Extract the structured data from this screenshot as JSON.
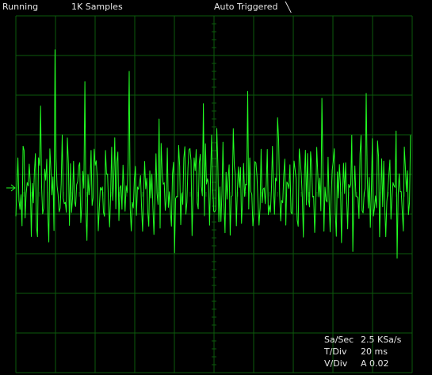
{
  "topbar": {
    "status": "Running",
    "samples": "1K Samples",
    "trigger": "Auto Triggered",
    "trigger_icon": "falling-edge-icon"
  },
  "readouts": {
    "sample_rate_label": "Sa/Sec",
    "sample_rate_value": "2.5 KSa/s",
    "time_div_label": "T/Div",
    "time_div_value": "20 ms",
    "volt_div_label": "V/Div",
    "volt_div_value": "A 0.02"
  },
  "colors": {
    "background": "#000000",
    "grid": "#0c5a0c",
    "trace": "#22ff22",
    "text": "#e6e6e6"
  },
  "trace": {
    "spike_count": 26,
    "spike_peak_start": 0.96,
    "spike_peak_end": 0.62,
    "noise_amplitude": 0.38
  }
}
